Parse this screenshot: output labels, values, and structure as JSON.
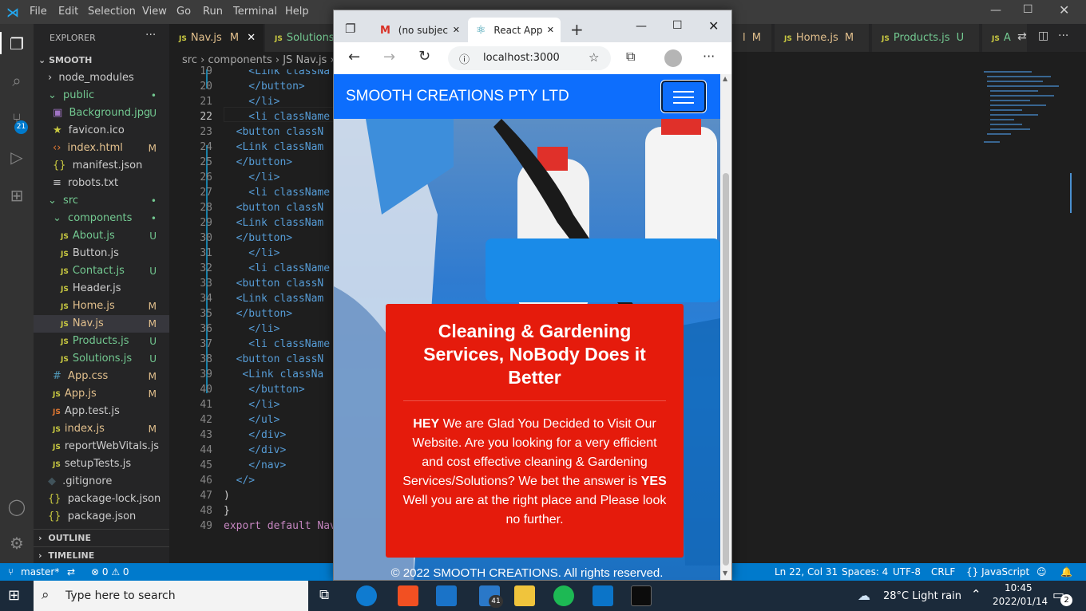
{
  "vscode": {
    "menu": [
      "File",
      "Edit",
      "Selection",
      "View",
      "Go",
      "Run",
      "Terminal",
      "Help"
    ],
    "explorer_title": "EXPLORER",
    "root": "SMOOTH",
    "tree": [
      {
        "label": "node_modules",
        "status": ""
      },
      {
        "label": "public",
        "status": "•"
      },
      {
        "label": "Background.jpg",
        "status": "U"
      },
      {
        "label": "favicon.ico",
        "status": ""
      },
      {
        "label": "index.html",
        "status": "M"
      },
      {
        "label": "manifest.json",
        "status": ""
      },
      {
        "label": "robots.txt",
        "status": ""
      },
      {
        "label": "src",
        "status": "•"
      },
      {
        "label": "components",
        "status": "•"
      },
      {
        "label": "About.js",
        "status": "U"
      },
      {
        "label": "Button.js",
        "status": ""
      },
      {
        "label": "Contact.js",
        "status": "U"
      },
      {
        "label": "Header.js",
        "status": ""
      },
      {
        "label": "Home.js",
        "status": "M"
      },
      {
        "label": "Nav.js",
        "status": "M"
      },
      {
        "label": "Products.js",
        "status": "U"
      },
      {
        "label": "Solutions.js",
        "status": "U"
      },
      {
        "label": "App.css",
        "status": "M"
      },
      {
        "label": "App.js",
        "status": "M"
      },
      {
        "label": "App.test.js",
        "status": ""
      },
      {
        "label": "index.js",
        "status": "M"
      },
      {
        "label": "reportWebVitals.js",
        "status": ""
      },
      {
        "label": "setupTests.js",
        "status": ""
      },
      {
        "label": ".gitignore",
        "status": ""
      },
      {
        "label": "package-lock.json",
        "status": ""
      },
      {
        "label": "package.json",
        "status": ""
      }
    ],
    "outline": "OUTLINE",
    "timeline": "TIMELINE",
    "tabs": [
      {
        "label": "Nav.js",
        "status": "M",
        "close": "✕"
      },
      {
        "label": "Solutions",
        "status": ""
      },
      {
        "label": "l",
        "status": "M"
      },
      {
        "label": "Home.js",
        "status": "M"
      },
      {
        "label": "Products.js",
        "status": "U"
      },
      {
        "label": "A",
        "status": ""
      }
    ],
    "breadcrumb": "src › components › JS Nav.js ›",
    "line_numbers": [
      "19",
      "20",
      "21",
      "22",
      "23",
      "24",
      "25",
      "26",
      "27",
      "28",
      "29",
      "30",
      "31",
      "32",
      "33",
      "34",
      "35",
      "36",
      "37",
      "38",
      "39",
      "40",
      "41",
      "42",
      "43",
      "44",
      "45",
      "46",
      "47",
      "48",
      "49"
    ],
    "code_lines": [
      {
        "text": "    <Link classNa"
      },
      {
        "text": "    </button>"
      },
      {
        "text": "    </li>"
      },
      {
        "text": "    <li className"
      },
      {
        "text": "  <button classN"
      },
      {
        "text": "  <Link classNam"
      },
      {
        "text": "  </button>"
      },
      {
        "text": "    </li>"
      },
      {
        "text": "    <li className"
      },
      {
        "text": "  <button classN"
      },
      {
        "text": "  <Link classNam"
      },
      {
        "text": "  </button>"
      },
      {
        "text": "    </li>"
      },
      {
        "text": "    <li className"
      },
      {
        "text": "  <button classN"
      },
      {
        "text": "  <Link classNam"
      },
      {
        "text": "  </button>"
      },
      {
        "text": "    </li>"
      },
      {
        "text": "    <li className"
      },
      {
        "text": "  <button classN"
      },
      {
        "text": "   <Link classNa"
      },
      {
        "text": "    </button>"
      },
      {
        "text": "    </li>"
      },
      {
        "text": "    </ul>"
      },
      {
        "text": "    </div>"
      },
      {
        "text": "    </div>"
      },
      {
        "text": "    </nav>"
      },
      {
        "text": "  </>"
      },
      {
        "text": ")"
      },
      {
        "text": "}"
      },
      {
        "text": "export default Nav"
      }
    ],
    "status": {
      "branch": "master*",
      "sync": "⇄",
      "problems": "⊗ 0 ⚠ 0",
      "position": "Ln 22, Col 31",
      "spaces": "Spaces: 4",
      "encoding": "UTF-8",
      "eol": "CRLF",
      "language": "{} JavaScript"
    },
    "source_control_badge": "21"
  },
  "browser": {
    "tabs": [
      {
        "label": "(no subjec",
        "close": "✕"
      },
      {
        "label": "React App",
        "close": "✕"
      }
    ],
    "new_tab": "+",
    "url": "localhost:3000",
    "brand": "SMOOTH CREATIONS PTY LTD",
    "card_title": "Cleaning & Gardening Services, NoBody Does it Better",
    "card_text_hey": "HEY",
    "card_text_1": " We are Glad You Decided to Visit Our Website. Are you looking for a very efficient and cost effective cleaning & Gardening Services/Solutions? We bet the answer is ",
    "card_text_yes": "YES",
    "card_text_2": " Well you are at the right place and Please look no further.",
    "footer": "© 2022 SMOOTH CREATIONS. All rights reserved."
  },
  "taskbar": {
    "search_placeholder": "Type here to search",
    "weather": "28°C  Light rain",
    "time": "10:45",
    "date": "2022/01/14",
    "badge": "41",
    "notif": "2"
  }
}
